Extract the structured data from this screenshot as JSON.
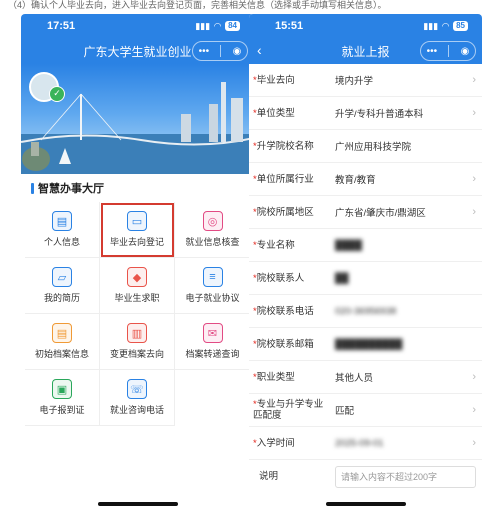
{
  "caption": "（4）确认个人毕业去向，进入毕业去向登记页面，完善相关信息（选择或手动填写相关信息）。",
  "left": {
    "time": "17:51",
    "battery": "84",
    "nav_title": "广东大学生就业创业",
    "section_title": "智慧办事大厅",
    "tiles": [
      {
        "label": "个人信息",
        "icon": "doc-icon",
        "glyph": "▤",
        "color": "blue"
      },
      {
        "label": "毕业去向登记",
        "icon": "briefcase-icon",
        "glyph": "▭",
        "color": "blue"
      },
      {
        "label": "就业信息核查",
        "icon": "shield-icon",
        "glyph": "◎",
        "color": "pink"
      },
      {
        "label": "我的简历",
        "icon": "folder-icon",
        "glyph": "▱",
        "color": "blue"
      },
      {
        "label": "毕业生求职",
        "icon": "graduation-cap-icon",
        "glyph": "◆",
        "color": "red"
      },
      {
        "label": "电子就业协议",
        "icon": "contract-icon",
        "glyph": "≡",
        "color": "blue"
      },
      {
        "label": "初始档案信息",
        "icon": "archive-icon",
        "glyph": "▤",
        "color": "orange"
      },
      {
        "label": "变更档案去向",
        "icon": "change-file-icon",
        "glyph": "▥",
        "color": "red"
      },
      {
        "label": "档案转递查询",
        "icon": "envelope-icon",
        "glyph": "✉",
        "color": "pink"
      },
      {
        "label": "电子报到证",
        "icon": "certificate-icon",
        "glyph": "▣",
        "color": "green"
      },
      {
        "label": "就业咨询电话",
        "icon": "phone-icon",
        "glyph": "☏",
        "color": "blue"
      }
    ]
  },
  "right": {
    "time": "15:51",
    "battery": "85",
    "nav_title": "就业上报",
    "rows": [
      {
        "label": "毕业去向",
        "value": "境内升学",
        "chevron": true,
        "required": true
      },
      {
        "label": "单位类型",
        "value": "升学/专科升普通本科",
        "chevron": true,
        "required": true
      },
      {
        "label": "升学院校名称",
        "value": "广州应用科技学院",
        "chevron": false,
        "required": true
      },
      {
        "label": "单位所属行业",
        "value": "教育/教育",
        "chevron": true,
        "required": true
      },
      {
        "label": "院校所属地区",
        "value": "广东省/肇庆市/鼎湖区",
        "chevron": true,
        "required": true
      },
      {
        "label": "专业名称",
        "value": "████",
        "chevron": false,
        "required": true,
        "blurred": true
      },
      {
        "label": "院校联系人",
        "value": "██",
        "chevron": false,
        "required": true,
        "blurred": true
      },
      {
        "label": "院校联系电话",
        "value": "020-36956938",
        "chevron": false,
        "required": true,
        "blurred": true
      },
      {
        "label": "院校联系邮箱",
        "value": "██████████",
        "chevron": false,
        "required": true,
        "blurred": true
      },
      {
        "label": "职业类型",
        "value": "其他人员",
        "chevron": true,
        "required": true
      },
      {
        "label": "专业与升学专业匹配度",
        "value": "匹配",
        "chevron": true,
        "required": true
      },
      {
        "label": "入学时间",
        "value": "2025-09-01",
        "chevron": true,
        "required": true,
        "blurred": true
      }
    ],
    "note_label": "说明",
    "note_placeholder": "请输入内容不超过200字"
  }
}
